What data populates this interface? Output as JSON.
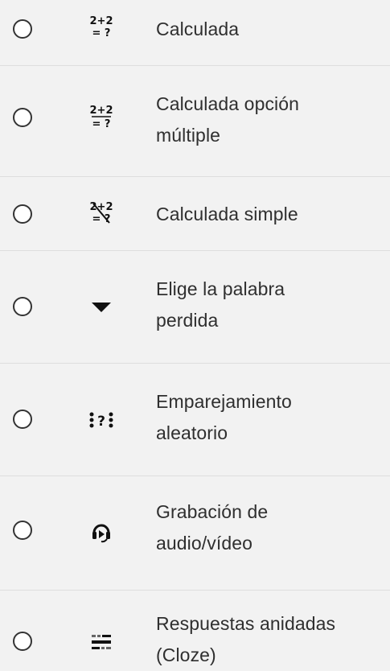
{
  "question_types": [
    {
      "name": "calculada",
      "icon": "calculated-icon",
      "line1": "Calculada",
      "line2": ""
    },
    {
      "name": "calculada-opcion-multiple",
      "icon": "calculated-multichoice-icon",
      "line1": "Calculada opción",
      "line2": "múltiple"
    },
    {
      "name": "calculada-simple",
      "icon": "calculated-simple-icon",
      "line1": "Calculada simple",
      "line2": ""
    },
    {
      "name": "elige-la-palabra-perdida",
      "icon": "dropdown-triangle-icon",
      "line1": "Elige la palabra",
      "line2": "perdida"
    },
    {
      "name": "emparejamiento-aleatorio",
      "icon": "random-matching-icon",
      "line1": "Emparejamiento",
      "line2": "aleatorio"
    },
    {
      "name": "grabacion-audio-video",
      "icon": "record-audio-video-icon",
      "line1": "Grabación de",
      "line2": "audio/vídeo"
    },
    {
      "name": "respuestas-anidadas-cloze",
      "icon": "cloze-icon",
      "line1": "Respuestas anidadas",
      "line2": "(Cloze)"
    }
  ],
  "icon_glyphs": {
    "calculated_top": "2+2",
    "calculated_bottom": "= ?",
    "matching_mark": "?"
  },
  "colors": {
    "background": "#f2f2f2",
    "text": "#2f2f2f",
    "radio_border": "#333333",
    "separator": "#dedede"
  }
}
